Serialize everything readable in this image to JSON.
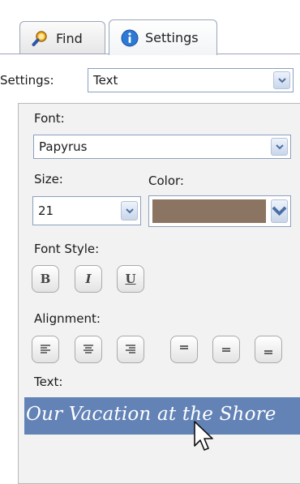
{
  "tabs": [
    {
      "label": "Find",
      "icon": "magnifier-icon"
    },
    {
      "label": "Settings",
      "icon": "info-icon",
      "active": true
    }
  ],
  "settings": {
    "label": "Settings:",
    "value": "Text"
  },
  "font": {
    "label": "Font:",
    "value": "Papyrus"
  },
  "size": {
    "label": "Size:",
    "value": "21"
  },
  "color": {
    "label": "Color:",
    "value_hex": "#8b7462"
  },
  "font_style": {
    "label": "Font Style:",
    "buttons": [
      "B",
      "I",
      "U"
    ]
  },
  "alignment": {
    "label": "Alignment:"
  },
  "text": {
    "label": "Text:",
    "value": "Our Vacation at the Shore"
  },
  "colors": {
    "selection": "#6383b7",
    "panel": "#f2f2f2",
    "border": "#8aa0bf"
  }
}
